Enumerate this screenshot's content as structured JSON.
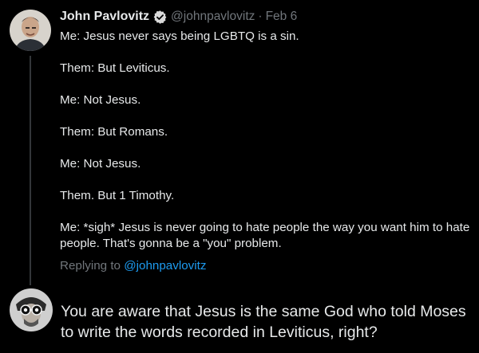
{
  "tweet": {
    "author_name": "John Pavlovitz",
    "handle": "@johnpavlovitz",
    "separator": "·",
    "date": "Feb 6",
    "lines": [
      "Me: Jesus never says being LGBTQ is a sin.",
      "Them: But Leviticus.",
      "Me: Not Jesus.",
      "Them: But Romans.",
      "Me: Not Jesus.",
      "Them. But 1 Timothy.",
      "Me: *sigh* Jesus is never going to hate people the way you want him to hate people. That's gonna be a \"you\" problem."
    ],
    "replying_prefix": "Replying to",
    "replying_handle": "@johnpavlovitz"
  },
  "reply": {
    "text": "You are aware that Jesus is the same God who told Moses to write the words recorded in Leviticus, right?"
  },
  "icons": {
    "verified": "verified-badge-icon"
  },
  "colors": {
    "background": "#000000",
    "text": "#e7e9ea",
    "muted": "#71767b",
    "link": "#1d9bf0"
  }
}
